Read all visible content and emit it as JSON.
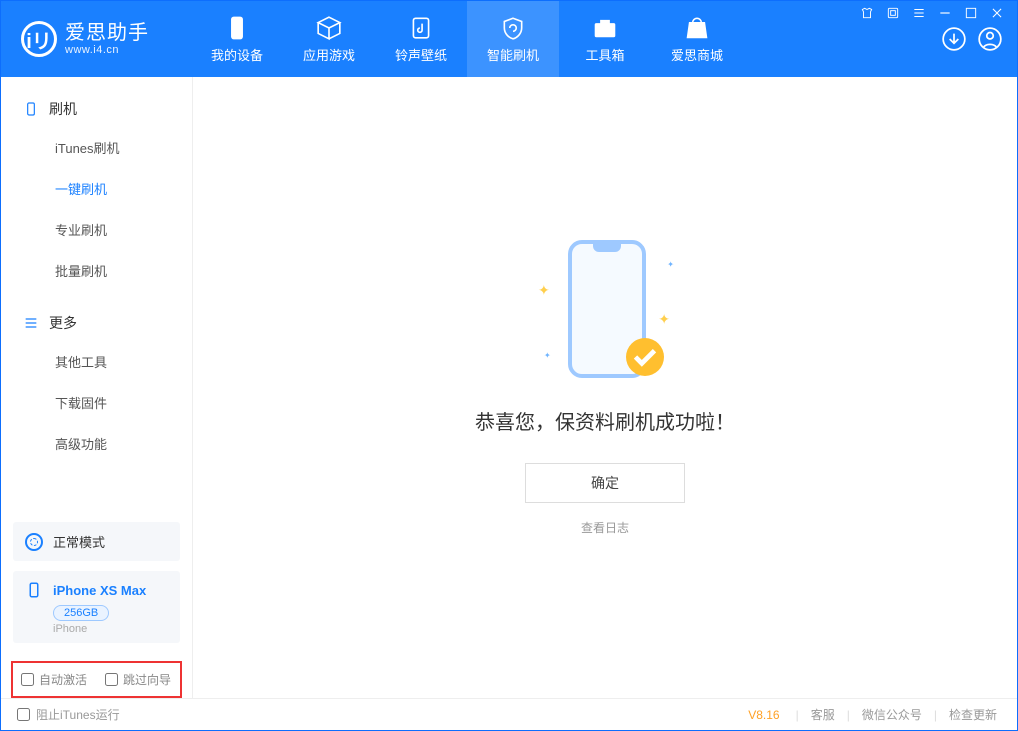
{
  "app": {
    "name": "爱思助手",
    "url": "www.i4.cn"
  },
  "nav": {
    "items": [
      {
        "label": "我的设备",
        "icon": "phone"
      },
      {
        "label": "应用游戏",
        "icon": "cube"
      },
      {
        "label": "铃声壁纸",
        "icon": "music"
      },
      {
        "label": "智能刷机",
        "icon": "refresh",
        "active": true
      },
      {
        "label": "工具箱",
        "icon": "toolbox"
      },
      {
        "label": "爱思商城",
        "icon": "bag"
      }
    ]
  },
  "sidebar": {
    "groups": [
      {
        "title": "刷机",
        "icon": "device",
        "items": [
          "iTunes刷机",
          "一键刷机",
          "专业刷机",
          "批量刷机"
        ],
        "active_index": 1
      },
      {
        "title": "更多",
        "icon": "menu",
        "items": [
          "其他工具",
          "下载固件",
          "高级功能"
        ]
      }
    ],
    "mode": "正常模式",
    "device": {
      "name": "iPhone XS Max",
      "capacity": "256GB",
      "type": "iPhone"
    },
    "options": {
      "auto_activate": "自动激活",
      "skip_guide": "跳过向导"
    }
  },
  "main": {
    "success_text": "恭喜您，保资料刷机成功啦！",
    "ok_label": "确定",
    "log_link": "查看日志"
  },
  "footer": {
    "block_itunes": "阻止iTunes运行",
    "version": "V8.16",
    "links": [
      "客服",
      "微信公众号",
      "检查更新"
    ]
  }
}
